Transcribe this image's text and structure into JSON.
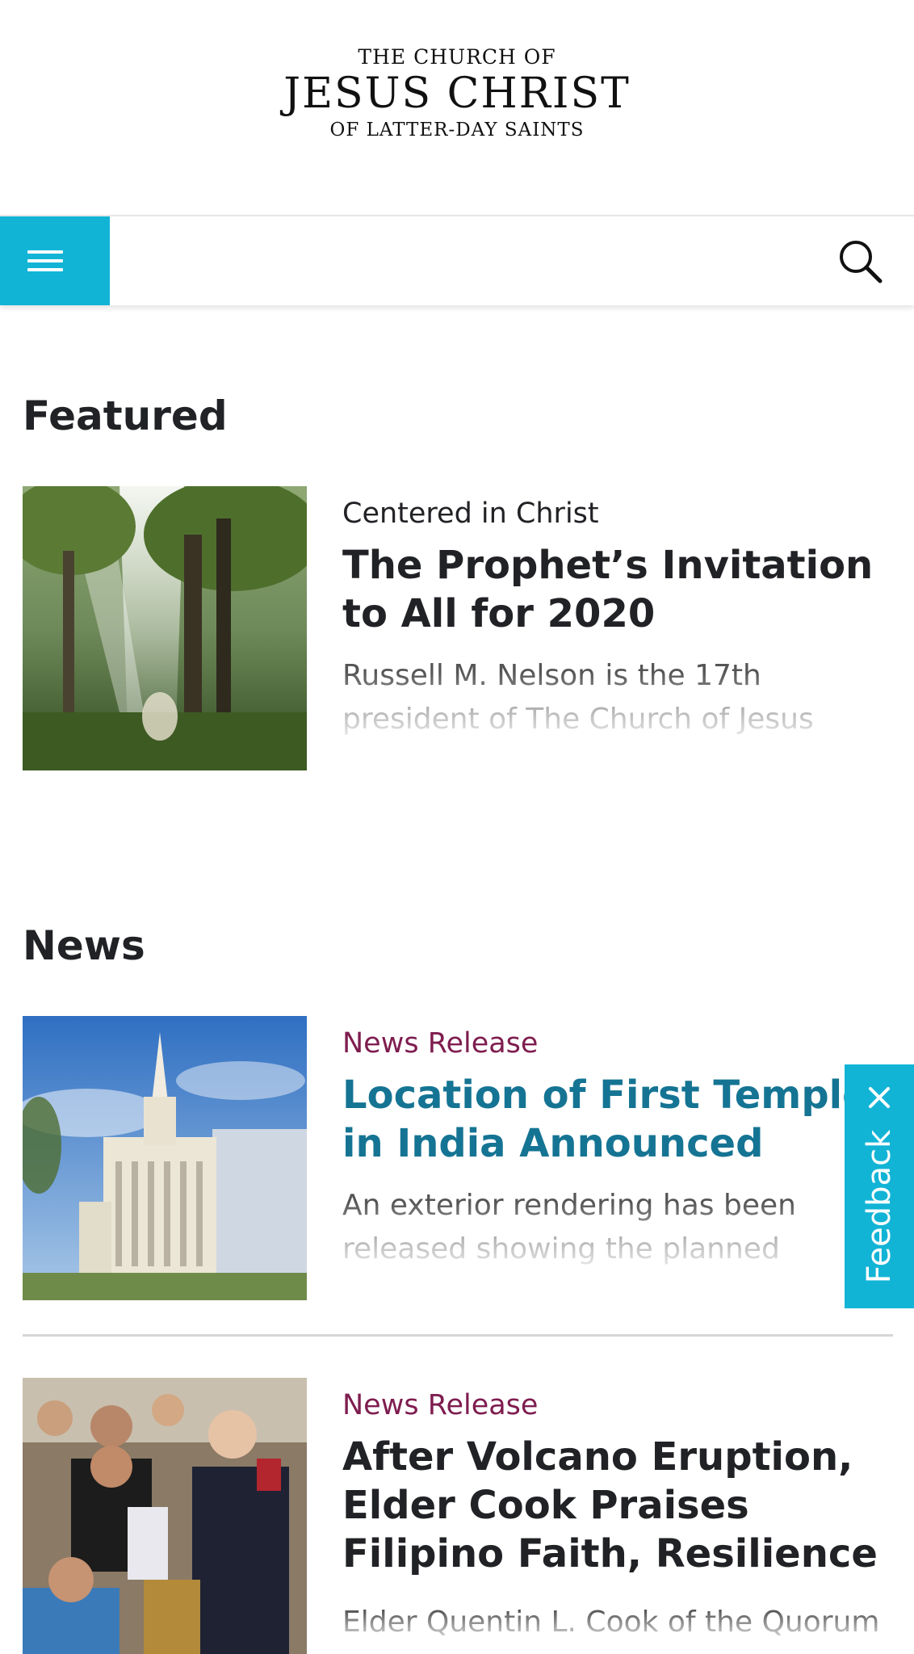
{
  "header": {
    "logo_line1": "THE CHURCH OF",
    "logo_line2": "JESUS CHRIST",
    "logo_line3": "OF LATTER-DAY SAINTS"
  },
  "nav": {
    "menu_icon": "hamburger-menu-icon",
    "search_icon": "search-icon",
    "accent_color": "#12b4d6"
  },
  "featured": {
    "heading": "Featured",
    "items": [
      {
        "category": "Centered in Christ",
        "title": "The Prophet’s Invitation to All for 2020",
        "description": "Russell M. Nelson is the 17th president of The Church of Jesus Christ of Latter-day Saints and"
      }
    ]
  },
  "news": {
    "heading": "News",
    "items": [
      {
        "category": "News Release",
        "title": "Location of First Temple in India Announced",
        "description": "An exterior rendering has been released showing the planned Bengaluru India Temple of The"
      },
      {
        "category": "News Release",
        "title": "After Volcano Eruption, Elder Cook Praises Filipino Faith, Resilience",
        "description": "Elder Quentin L. Cook of the Quorum"
      }
    ]
  },
  "feedback": {
    "label": "Feedback",
    "close_icon": "close-icon"
  },
  "colors": {
    "category_news": "#7e1d4f",
    "link_title": "#157493",
    "feedback_bg": "#12b4d6"
  }
}
